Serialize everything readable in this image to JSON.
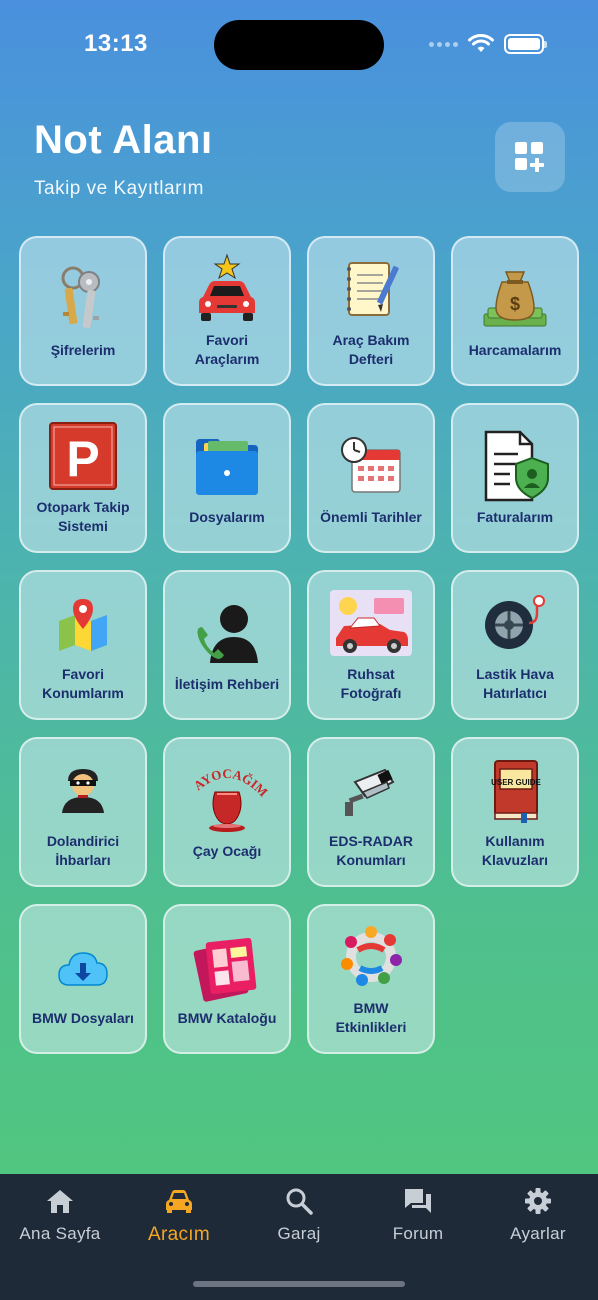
{
  "status_bar": {
    "time": "13:13"
  },
  "header": {
    "title": "Not Alanı",
    "subtitle": "Takip ve Kayıtlarım"
  },
  "tiles": [
    {
      "label": "Şifrelerim",
      "icon": "keys-icon"
    },
    {
      "label": "Favori\nAraçlarım",
      "icon": "favorite-car-icon"
    },
    {
      "label": "Araç Bakım\nDefteri",
      "icon": "notebook-icon"
    },
    {
      "label": "Harcamalarım",
      "icon": "money-bag-icon"
    },
    {
      "label": "Otopark Takip\nSistemi",
      "icon": "parking-icon"
    },
    {
      "label": "Dosyalarım",
      "icon": "folder-icon"
    },
    {
      "label": "Önemli Tarihler",
      "icon": "calendar-clock-icon"
    },
    {
      "label": "Faturalarım",
      "icon": "invoice-icon"
    },
    {
      "label": "Favori\nKonumlarım",
      "icon": "map-pin-icon"
    },
    {
      "label": "İletişim Rehberi",
      "icon": "contact-phone-icon"
    },
    {
      "label": "Ruhsat\nFotoğrafı",
      "icon": "car-photo-icon"
    },
    {
      "label": "Lastik Hava\nHatırlatıcı",
      "icon": "tire-icon"
    },
    {
      "label": "Dolandirici\nİhbarları",
      "icon": "thief-icon"
    },
    {
      "label": "Çay Ocağı",
      "icon": "tea-glass-icon",
      "logo_text": "ÇAYOCAĞIM"
    },
    {
      "label": "EDS-RADAR\nKonumları",
      "icon": "cctv-camera-icon"
    },
    {
      "label": "Kullanım\nKlavuzları",
      "icon": "user-guide-book-icon",
      "book_text": "USER GUIDE"
    },
    {
      "label": "BMW Dosyaları",
      "icon": "cloud-download-icon"
    },
    {
      "label": "BMW Kataloğu",
      "icon": "catalog-icon"
    },
    {
      "label": "BMW\nEtkinlikleri",
      "icon": "community-icon"
    }
  ],
  "tab_bar": {
    "items": [
      {
        "label": "Ana Sayfa",
        "icon": "home-icon"
      },
      {
        "label": "Aracım",
        "icon": "car-icon",
        "active": true
      },
      {
        "label": "Garaj",
        "icon": "search-icon"
      },
      {
        "label": "Forum",
        "icon": "forum-icon"
      },
      {
        "label": "Ayarlar",
        "icon": "gear-icon"
      }
    ]
  },
  "colors": {
    "tile_text": "#1c2e6e",
    "active_tab": "#f5a623",
    "tab_bar_bg": "#1e2a38"
  }
}
